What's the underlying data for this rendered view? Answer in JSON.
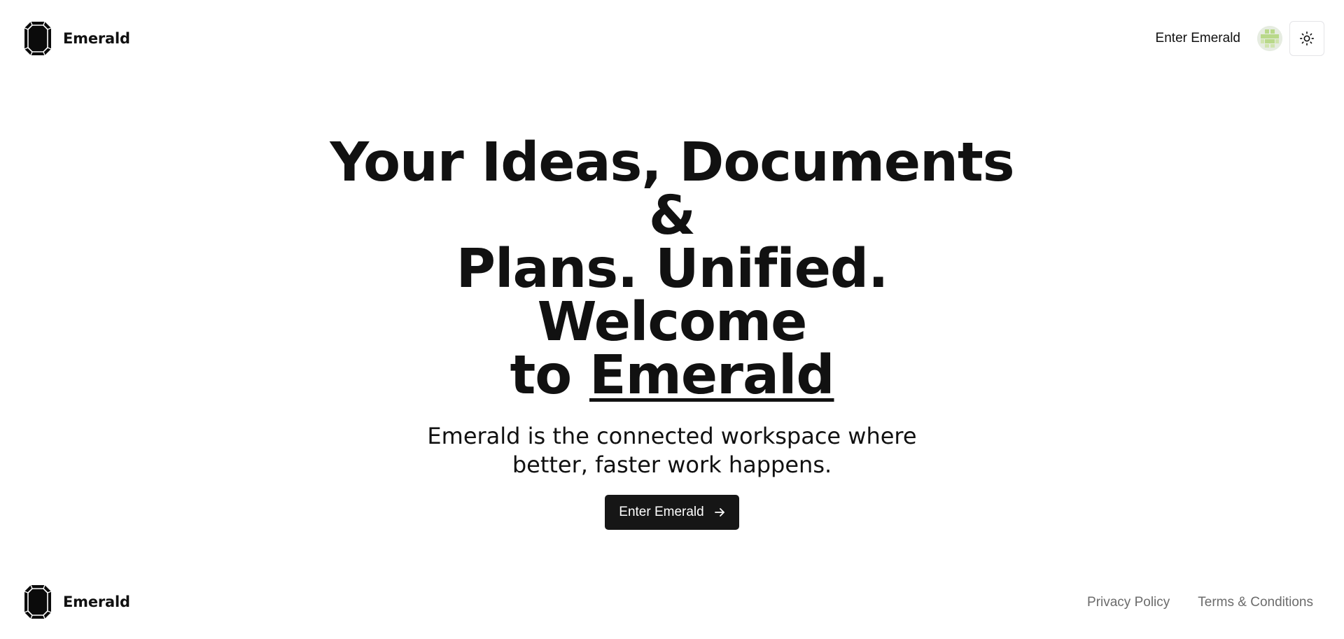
{
  "header": {
    "brand_name": "Emerald",
    "enter_link": "Enter Emerald"
  },
  "hero": {
    "title_line1": "Your Ideas, Documents &",
    "title_line2": "Plans. Unified. Welcome",
    "title_line3_prefix": "to",
    "title_highlight": "Emerald",
    "subtitle": "Emerald is the connected workspace where better, faster work happens.",
    "cta_label": "Enter Emerald"
  },
  "footer": {
    "brand_name": "Emerald",
    "links": [
      "Privacy Policy",
      "Terms & Conditions"
    ]
  },
  "icons": {
    "logo": "emerald-gem-icon",
    "avatar": "user-avatar",
    "theme": "sun-icon",
    "cta_arrow": "arrow-right-icon"
  },
  "colors": {
    "button_bg": "#161616",
    "text": "#111111",
    "muted": "#6b6b6b",
    "avatar_accent": "#b9d98a"
  }
}
